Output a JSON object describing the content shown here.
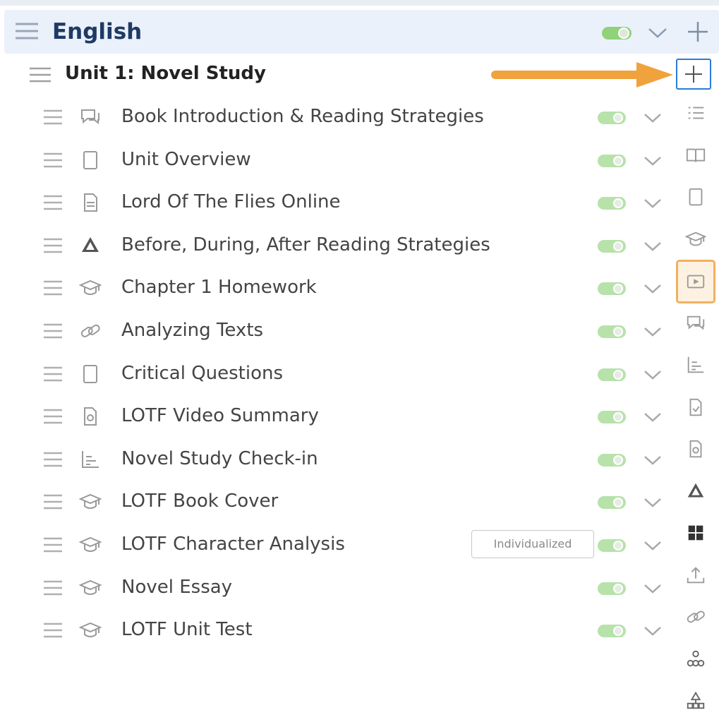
{
  "course": {
    "title": "English"
  },
  "unit": {
    "title": "Unit 1: Novel Study"
  },
  "items": [
    {
      "label": "Book Introduction & Reading Strategies",
      "icon": "discussion-icon"
    },
    {
      "label": "Unit Overview",
      "icon": "page-icon"
    },
    {
      "label": "Lord Of The Flies Online",
      "icon": "web-document-icon"
    },
    {
      "label": "Before, During, After Reading Strategies",
      "icon": "google-drive-icon"
    },
    {
      "label": "Chapter 1 Homework",
      "icon": "assignment-icon"
    },
    {
      "label": "Analyzing Texts",
      "icon": "link-icon"
    },
    {
      "label": "Critical Questions",
      "icon": "page-icon"
    },
    {
      "label": "LOTF Video Summary",
      "icon": "file-icon"
    },
    {
      "label": "Novel Study Check-in",
      "icon": "assessment-icon"
    },
    {
      "label": "LOTF Book Cover",
      "icon": "assignment-icon"
    },
    {
      "label": "LOTF Character Analysis",
      "icon": "assignment-icon",
      "badge": "Individualized"
    },
    {
      "label": "Novel Essay",
      "icon": "assignment-icon"
    },
    {
      "label": "LOTF Unit Test",
      "icon": "assignment-icon"
    }
  ],
  "toolbar_icons": [
    "list-icon",
    "book-icon",
    "page-icon",
    "assignment-icon",
    "video-icon",
    "discussion-icon",
    "assessment-icon",
    "document-icon",
    "file-icon",
    "google-drive-icon",
    "apps-icon",
    "upload-icon",
    "link-icon",
    "tree-icon",
    "sitemap-icon"
  ],
  "colors": {
    "course_bg": "#eaf1fb",
    "toggle_green": "#7fc86b",
    "accent_blue": "#2b7bd6",
    "arrow_orange": "#f0a23c",
    "selected_border": "#f0b060"
  }
}
